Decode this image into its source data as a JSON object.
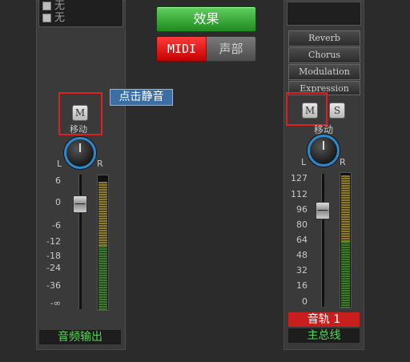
{
  "left_strip": {
    "options": [
      "无",
      "无"
    ],
    "mute_label": "M",
    "move_label": "移动",
    "pan_left": "L",
    "pan_right": "R",
    "scale": [
      "6",
      "0",
      "-6",
      "-12",
      "-18",
      "-24",
      "-36",
      "-∞"
    ],
    "fader_level_db": 0,
    "name": "音频输出"
  },
  "center": {
    "effects_button": "效果",
    "midi_button": "MIDI",
    "voice_button": "声部",
    "tooltip": "点击静音"
  },
  "right_strip": {
    "fx_slots": [
      "Reverb",
      "Chorus",
      "Modulation",
      "Expression"
    ],
    "mute_label": "M",
    "solo_label": "S",
    "move_label": "移动",
    "pan_left": "L",
    "pan_right": "R",
    "scale": [
      "127",
      "112",
      "96",
      "80",
      "64",
      "48",
      "32",
      "16",
      "0"
    ],
    "fader_level": 96,
    "track_name": "音轨 1",
    "bus_name": "主总线"
  },
  "colors": {
    "accent_blue": "#2a8ad0",
    "highlight_red": "#e02020",
    "name_green": "#5ad05a",
    "track_red": "#c81e1e"
  }
}
